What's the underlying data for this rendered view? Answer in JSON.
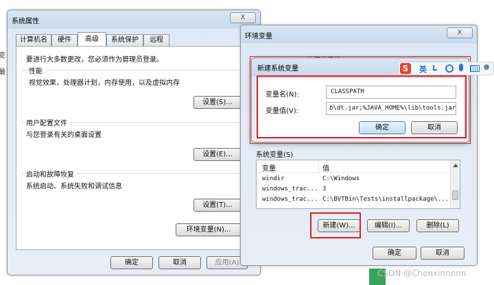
{
  "sysprop": {
    "title": "系统属性",
    "close_label": "X",
    "tabs": [
      "计算机名",
      "硬件",
      "高级",
      "系统保护",
      "远程"
    ],
    "admin_note": "要进行大多数更改，您必须作为管理员登录。",
    "performance": {
      "title": "性能",
      "desc": "视觉效果，处理器计划，内存使用，以及虚拟内存",
      "button": "设置(S)..."
    },
    "profile": {
      "title": "用户配置文件",
      "desc": "与您登录有关的桌面设置",
      "button": "设置(E)..."
    },
    "startup": {
      "title": "启动和故障恢复",
      "desc": "系统启动、系统失败和调试信息",
      "button": "设置(T)..."
    },
    "env_button": "环境变量(N)...",
    "ok": "确定",
    "cancel": "取消",
    "apply": "应用(A)"
  },
  "edge_text": {
    "line1": "变",
    "line2": "最"
  },
  "env": {
    "title": "环境变量",
    "close_label": "X",
    "user_section_partial": "的用户变量(U)",
    "system_section": "系统变量(S)",
    "columns": [
      "变量",
      "值"
    ],
    "rows": [
      {
        "var": "windir",
        "val": "C:\\Windows"
      },
      {
        "var": "windows_trac...",
        "val": "3"
      },
      {
        "var": "windows_trac...",
        "val": "C:\\BVTBin\\Tests\\installpackage\\..."
      }
    ],
    "new_button": "新建(W)...",
    "edit_button": "编辑(I)...",
    "delete_button": "删除(L)",
    "ok": "确定",
    "cancel": "取消"
  },
  "newvar": {
    "title": "新建系统变量",
    "name_label": "变量名(N):",
    "name_value": "CLASSPATH",
    "value_label": "变量值(V):",
    "value_value": "b\\dt.jar;%JAVA_HOME%\\lib\\tools.jar;",
    "ok": "确定",
    "cancel": "取消"
  },
  "ime": {
    "logo": "S",
    "mode": "英"
  },
  "watermark": "CSDN @Chenxinnnnn",
  "colors": {
    "accent_red": "#e02020",
    "ime_red": "#e8442c",
    "ime_blue": "#1d7bd8"
  }
}
